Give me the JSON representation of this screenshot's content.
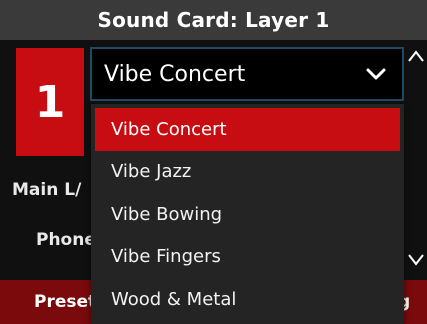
{
  "title": "Sound Card: Layer 1",
  "layer_number": "1",
  "labels": {
    "main": "Main L/",
    "phones": "Phone"
  },
  "bottom_bar": {
    "left": "Preset",
    "right": "g"
  },
  "select": {
    "value": "Vibe Concert",
    "options": [
      "Vibe Concert",
      "Vibe Jazz",
      "Vibe Bowing",
      "Vibe Fingers",
      "Wood & Metal"
    ],
    "selected_index": 0
  },
  "icons": {
    "chevron": "chevron-down-icon",
    "scroll_up": "chevron-up-icon",
    "scroll_down": "chevron-down-icon"
  },
  "colors": {
    "accent_red": "#c80d12",
    "bottom_bar": "#7a0a0c",
    "title_bar": "#3a3a3a",
    "select_border": "#1f4a66",
    "dropdown_bg": "#242424"
  }
}
